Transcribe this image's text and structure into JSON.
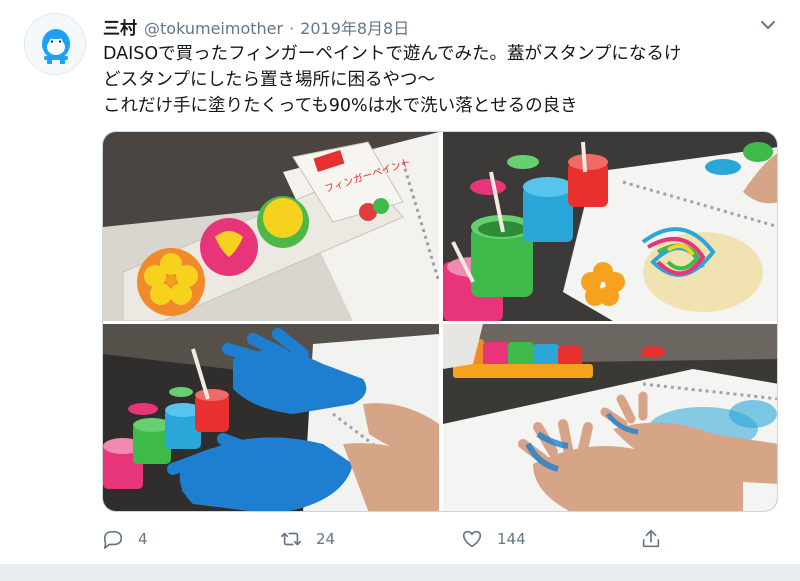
{
  "tweet": {
    "author_name": "三村",
    "author_handle": "@tokumeimother",
    "separator": "·",
    "date": "2019年8月8日",
    "text_lines": [
      "DAISOで買ったフィンガーペイントで遊んでみた。蓋がスタンプになるけ",
      "どスタンプにしたら置き場所に困るやつ〜",
      "これだけ手に塗りたくっても90%は水で洗い落とせるの良き"
    ],
    "package_text": "フィンガーペイント"
  },
  "actions": {
    "reply_count": "4",
    "retweet_count": "24",
    "like_count": "144"
  },
  "icons": {
    "avatar": "default-egg-avatar",
    "menu": "chevron-down-icon",
    "reply": "reply-icon",
    "retweet": "retweet-icon",
    "like": "heart-icon",
    "share": "share-icon"
  },
  "colors": {
    "text": "#14171a",
    "secondary": "#657786",
    "border": "#e6ecf0"
  }
}
